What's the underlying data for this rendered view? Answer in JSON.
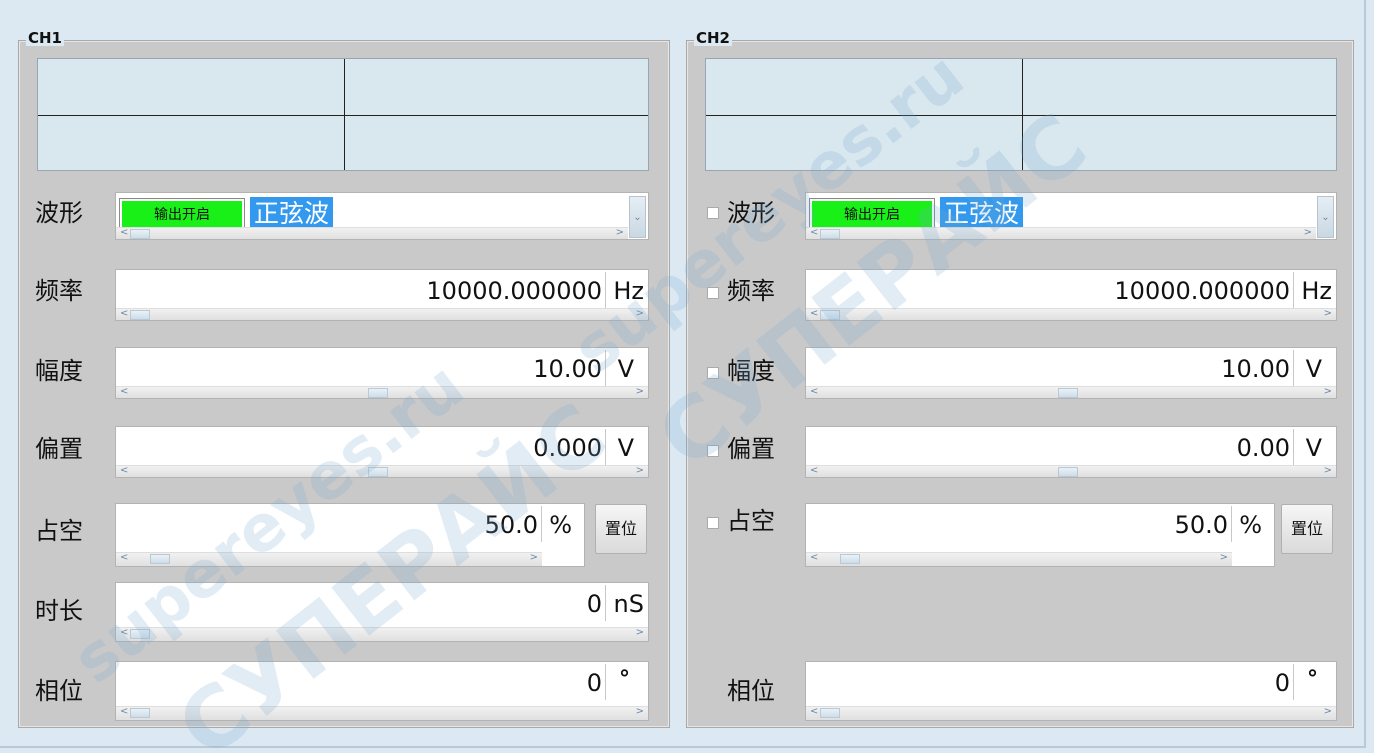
{
  "channels": [
    {
      "title": "CH1",
      "labels": {
        "waveform": "波形",
        "frequency": "频率",
        "amplitude": "幅度",
        "offset": "偏置",
        "duty": "占空",
        "duration": "时长",
        "phase": "相位"
      },
      "output_button": "输出开启",
      "waveform_value": "正弦波",
      "frequency": {
        "value": "10000.000000",
        "unit": "Hz"
      },
      "amplitude": {
        "value": "10.00",
        "unit": "V"
      },
      "offset": {
        "value": "0.000",
        "unit": "V"
      },
      "duty": {
        "value": "50.0",
        "unit": "%"
      },
      "duration": {
        "value": "0",
        "unit": "nS"
      },
      "phase": {
        "value": "0",
        "unit": "°"
      },
      "reset_button": "置位"
    },
    {
      "title": "CH2",
      "labels": {
        "waveform": "波形",
        "frequency": "频率",
        "amplitude": "幅度",
        "offset": "偏置",
        "duty": "占空",
        "phase": "相位"
      },
      "output_button": "输出开启",
      "waveform_value": "正弦波",
      "frequency": {
        "value": "10000.000000",
        "unit": "Hz"
      },
      "amplitude": {
        "value": "10.00",
        "unit": "V"
      },
      "offset": {
        "value": "0.00",
        "unit": "V"
      },
      "duty": {
        "value": "50.0",
        "unit": "%"
      },
      "phase": {
        "value": "0",
        "unit": "°"
      },
      "reset_button": "置位"
    }
  ],
  "scroll": {
    "left_arrow": "<",
    "right_arrow": ">",
    "dropdown_arrow": "⌄"
  },
  "watermark": {
    "line1": "supereyes.ru",
    "line2": "СУПЕРАЙС"
  }
}
